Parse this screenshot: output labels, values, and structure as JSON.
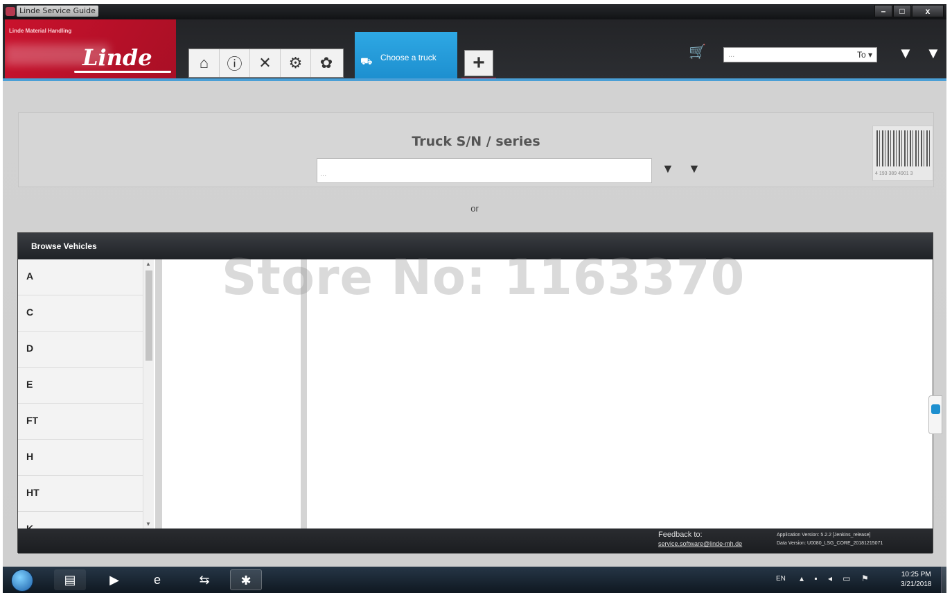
{
  "window": {
    "title": "Linde Service Guide",
    "minimize_icon": "minimize-icon",
    "maximize_icon": "maximize-icon",
    "close_icon": "close-icon"
  },
  "header": {
    "logo_subtitle": "Linde Material Handling",
    "logo_brand": "Linde",
    "icon_buttons": [
      "home-icon",
      "info-icon",
      "tools-icon",
      "truck-parts-icon",
      "settings-icon"
    ],
    "active_tab_label": "Choose a truck",
    "add_tab_symbol": "+",
    "search_placeholder": "...",
    "search_to_label": "To",
    "accent_color": "#1d8fcf",
    "brand_color": "#c9122d"
  },
  "search": {
    "title": "Truck S/N / series",
    "placeholder": "...",
    "barcode_number": "4 193 389 4901 3"
  },
  "or_label": "or",
  "browse": {
    "title": "Browse Vehicles",
    "letters": [
      "A",
      "C",
      "D",
      "E",
      "FT",
      "H",
      "HT",
      "K"
    ],
    "watermark": "Store No: 1163370"
  },
  "footer": {
    "feedback_label": "Feedback to:",
    "feedback_email": "service.software@linde-mh.de",
    "app_version": "Application Version: 5.2.2 [Jenkins_release]",
    "data_version": "Data Version: U0080_LSG_CORE_20181215071"
  },
  "taskbar": {
    "language": "EN",
    "time": "10:25 PM",
    "date": "3/21/2018"
  }
}
